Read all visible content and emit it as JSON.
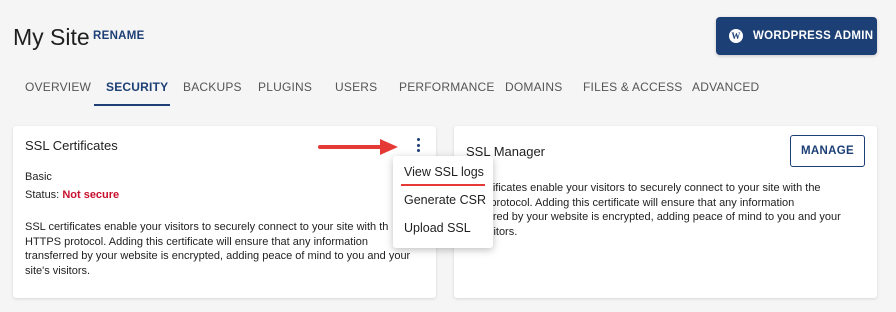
{
  "header": {
    "site_title": "My Site",
    "rename_label": "RENAME",
    "wp_button_label": "WORDPRESS ADMIN",
    "wp_icon_glyph": "W"
  },
  "tabs": [
    {
      "label": "OVERVIEW"
    },
    {
      "label": "SECURITY"
    },
    {
      "label": "BACKUPS"
    },
    {
      "label": "PLUGINS"
    },
    {
      "label": "USERS"
    },
    {
      "label": "PERFORMANCE"
    },
    {
      "label": "DOMAINS"
    },
    {
      "label": "FILES & ACCESS"
    },
    {
      "label": "ADVANCED"
    }
  ],
  "active_tab": "SECURITY",
  "ssl_certificates": {
    "title": "SSL Certificates",
    "plan": "Basic",
    "status_label": "Status:",
    "status_value": "Not secure",
    "description_lines": [
      "SSL certificates enable your visitors to securely connect to your site with th",
      "HTTPS protocol. Adding this certificate will ensure that any information",
      "transferred by your website is encrypted, adding peace of mind to you and your",
      "site's visitors."
    ]
  },
  "ssl_manager": {
    "title": "SSL Manager",
    "manage_label": "MANAGE",
    "description_lines": [
      "ertificates enable your visitors to securely connect to your site with the",
      "S protocol. Adding this certificate will ensure that any information",
      "ferred by your website is encrypted, adding peace of mind to you and your",
      "visitors."
    ]
  },
  "dropdown_menu": {
    "items": [
      "View SSL logs",
      "Generate CSR",
      "Upload SSL"
    ]
  },
  "colors": {
    "brand": "#1c3f75",
    "status_danger": "#c8102e",
    "annotation_arrow": "#e53935",
    "background": "#f5f5f5"
  },
  "icons": {
    "wordpress": "wordpress-icon",
    "kebab": "kebab-menu-icon",
    "annotation": "red-arrow-icon"
  }
}
